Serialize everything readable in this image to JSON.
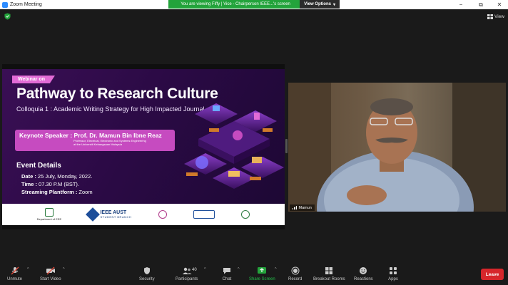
{
  "window": {
    "title": "Zoom Meeting",
    "minimize": "−",
    "restore": "⧉",
    "close": "✕"
  },
  "share_banner": {
    "text": "You are viewing Fiffy | Vice - Chairperson IEEE...'s screen",
    "view_options": "View Options",
    "view_options_caret": "▾"
  },
  "view_button": {
    "label": "View",
    "icon": "grid-icon"
  },
  "security_shield": {
    "icon": "shield-icon",
    "color": "#23a33b"
  },
  "slide": {
    "tag": "Webinar on",
    "headline": "Pathway to Research Culture",
    "subhead": "Colloquia 1 : Academic Writing Strategy for High Impacted Journal",
    "keynote_label": "Keynote Speaker : Prof. Dr. Mamun Bin Ibne Reaz",
    "keynote_affil_1": "Professor, Electrical, Electronic and Systems Engineering",
    "keynote_affil_2": "at the Universiti Kebangsaan Malaysia",
    "event_title": "Event Details",
    "date_label": "Date :",
    "date_value": " 25 July, Monday, 2022.",
    "time_label": "Time :",
    "time_value": " 07.30 P.M (BST).",
    "platform_label": "Streaming Plantform :",
    "platform_value": " Zoom",
    "footer_logos": {
      "dept": "Department of EEE",
      "ieee_main": "IEEE AUST",
      "ieee_sub": "STUDENT BRANCH"
    },
    "colors": {
      "bg": "#2b0a45",
      "accent": "#c64bc0",
      "tag": "#e26bd6"
    }
  },
  "video": {
    "participant_name": "Mamun"
  },
  "toolbar": {
    "unmute": "Unmute",
    "start_video": "Start Video",
    "security": "Security",
    "participants": "Participants",
    "participants_count": "40",
    "chat": "Chat",
    "share_screen": "Share Screen",
    "record": "Record",
    "breakout_rooms": "Breakout Rooms",
    "reactions": "Reactions",
    "apps": "Apps",
    "leave": "Leave",
    "caret": "^",
    "colors": {
      "share": "#23a33b",
      "leave": "#d6262b",
      "muted": "#e34a3a"
    }
  }
}
